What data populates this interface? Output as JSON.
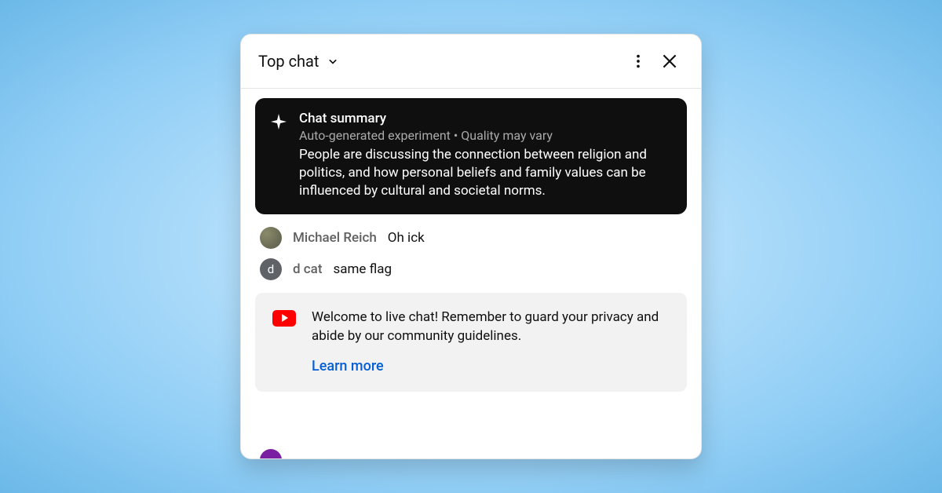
{
  "header": {
    "title": "Top chat"
  },
  "summary": {
    "title": "Chat summary",
    "subtitle": "Auto-generated experiment • Quality may vary",
    "body": "People are discussing the connection between religion and politics, and how personal beliefs and family values can be influenced by cultural and societal norms."
  },
  "messages": [
    {
      "author": "Michael Reich",
      "text": "Oh ick",
      "avatar_initial": ""
    },
    {
      "author": "d cat",
      "text": "same flag",
      "avatar_initial": "d"
    }
  ],
  "welcome": {
    "text": "Welcome to live chat! Remember to guard your privacy and abide by our community guidelines.",
    "link_label": "Learn more"
  }
}
